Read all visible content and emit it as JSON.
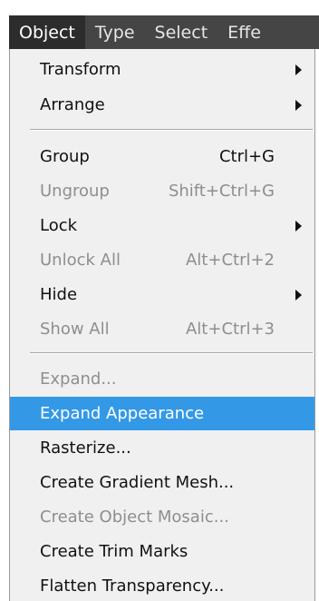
{
  "menubar": {
    "items": [
      "Object",
      "Type",
      "Select",
      "Effe"
    ],
    "active_index": 0
  },
  "menu": {
    "items": [
      {
        "label": "Transform",
        "shortcut": "",
        "submenu": true,
        "enabled": true
      },
      {
        "label": "Arrange",
        "shortcut": "",
        "submenu": true,
        "enabled": true
      },
      {
        "label": "Group",
        "shortcut": "Ctrl+G",
        "submenu": false,
        "enabled": true
      },
      {
        "label": "Ungroup",
        "shortcut": "Shift+Ctrl+G",
        "submenu": false,
        "enabled": false
      },
      {
        "label": "Lock",
        "shortcut": "",
        "submenu": true,
        "enabled": true
      },
      {
        "label": "Unlock All",
        "shortcut": "Alt+Ctrl+2",
        "submenu": false,
        "enabled": false
      },
      {
        "label": "Hide",
        "shortcut": "",
        "submenu": true,
        "enabled": true
      },
      {
        "label": "Show All",
        "shortcut": "Alt+Ctrl+3",
        "submenu": false,
        "enabled": false
      },
      {
        "label": "Expand...",
        "shortcut": "",
        "submenu": false,
        "enabled": false
      },
      {
        "label": "Expand Appearance",
        "shortcut": "",
        "submenu": false,
        "enabled": true,
        "highlighted": true
      },
      {
        "label": "Rasterize...",
        "shortcut": "",
        "submenu": false,
        "enabled": true
      },
      {
        "label": "Create Gradient Mesh...",
        "shortcut": "",
        "submenu": false,
        "enabled": true
      },
      {
        "label": "Create Object Mosaic...",
        "shortcut": "",
        "submenu": false,
        "enabled": false
      },
      {
        "label": "Create Trim Marks",
        "shortcut": "",
        "submenu": false,
        "enabled": true
      },
      {
        "label": "Flatten Transparency...",
        "shortcut": "",
        "submenu": false,
        "enabled": true
      }
    ]
  },
  "colors": {
    "menubar_bg": "#454545",
    "menubar_active_bg": "#2c2c2c",
    "menu_bg": "#f0f0f0",
    "highlight_bg": "#3399e6",
    "disabled_text": "#8e8e8e"
  }
}
